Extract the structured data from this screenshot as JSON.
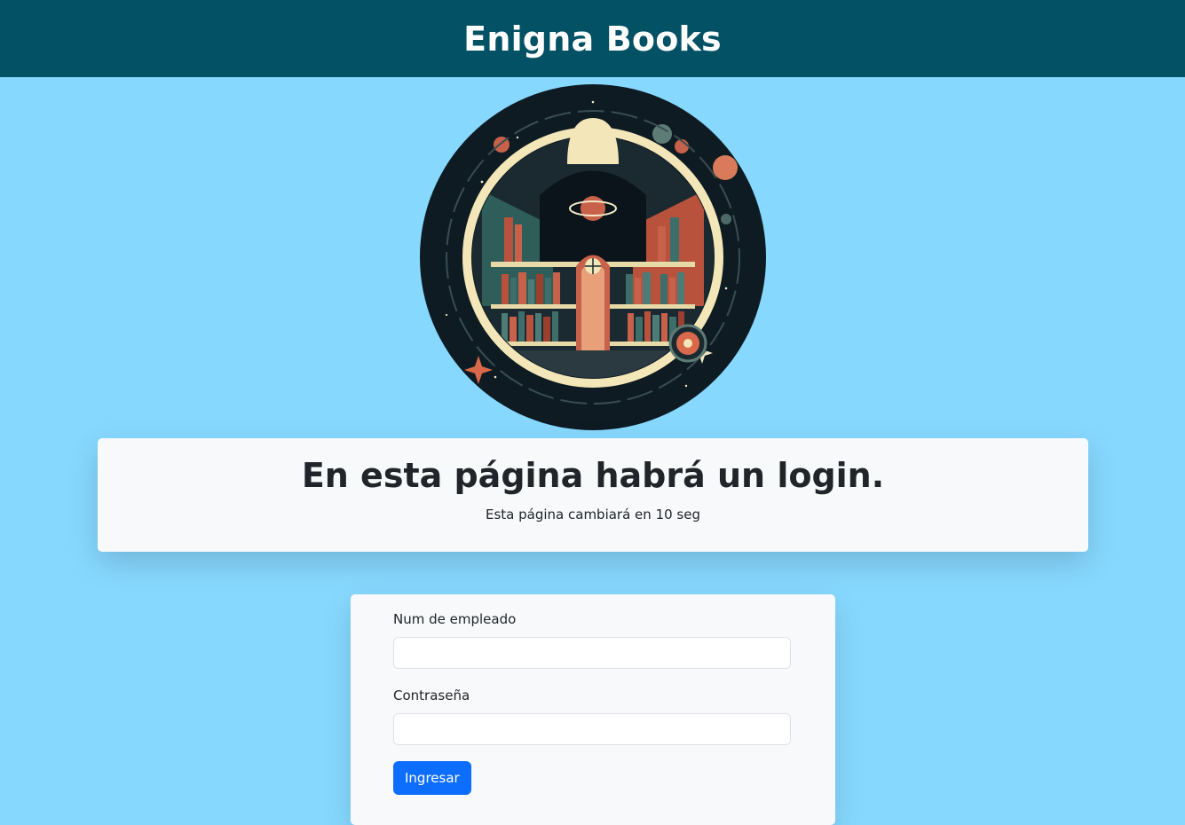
{
  "header": {
    "title": "Enigna Books"
  },
  "banner": {
    "heading": "En esta página habrá un login.",
    "subtext": "Esta página cambiará en 10 seg"
  },
  "login": {
    "employee_label": "Num de empleado",
    "employee_value": "",
    "password_label": "Contraseña",
    "password_value": "",
    "submit_label": "Ingresar"
  },
  "colors": {
    "page_background": "#87d8ff",
    "navbar": "#035164",
    "card": "#f8f9fa",
    "primary_button": "#0d6efd"
  },
  "icons": {
    "logo": "library-observatory-logo"
  }
}
